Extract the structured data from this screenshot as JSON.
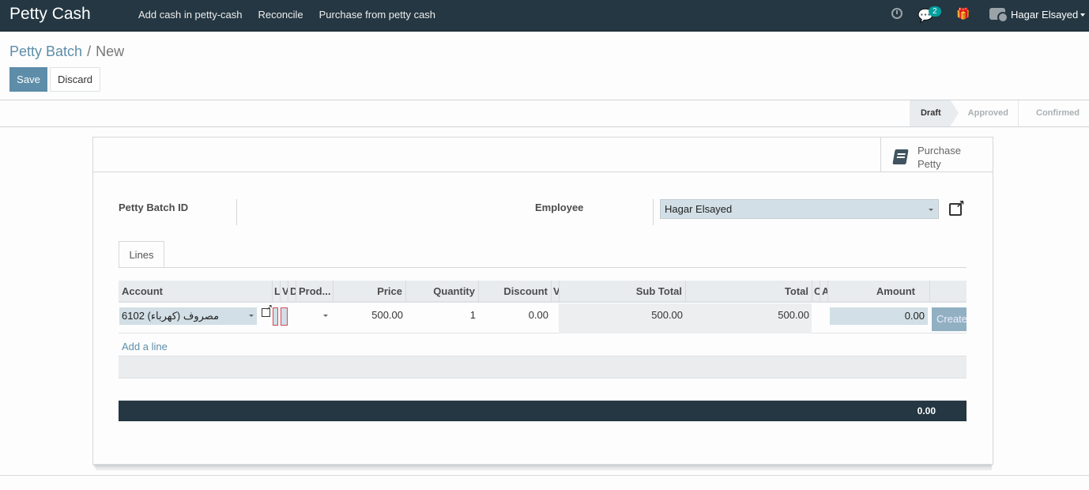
{
  "navbar": {
    "app_title": "Petty Cash",
    "menu_items": [
      "Add cash in petty-cash",
      "Reconcile",
      "Purchase from petty cash"
    ],
    "messages_badge": "2",
    "user_name": "Hagar Elsayed",
    "icons": [
      "clock-icon",
      "chat-icon",
      "gift-icon",
      "camera-avatar-icon",
      "caret-down-icon"
    ]
  },
  "breadcrumb": {
    "parent": "Petty Batch",
    "separator": "/",
    "current": "New"
  },
  "toolbar": {
    "save_label": "Save",
    "discard_label": "Discard"
  },
  "statusbar": {
    "stages": [
      "Draft",
      "Approved",
      "Confirmed"
    ],
    "active_stage": "Draft"
  },
  "smart_button": {
    "line1": "Purchase",
    "line2": "Petty",
    "icon": "book-icon"
  },
  "form": {
    "batch_id_label": "Petty Batch ID",
    "batch_id_value": "",
    "employee_label": "Employee",
    "employee_value": "Hagar Elsayed"
  },
  "tabs": [
    {
      "label": "Lines",
      "active": true
    }
  ],
  "lines_table": {
    "columns": [
      "Account",
      "L",
      "V",
      "D",
      "Prod...",
      "Price",
      "Quantity",
      "Discount",
      "V",
      "Sub Total",
      "Total",
      "C",
      "A",
      "Amount",
      ""
    ],
    "rows": [
      {
        "account": "6102  مصروف (كهرباء)",
        "product": "",
        "price": "500.00",
        "quantity": "1",
        "discount": "0.00",
        "sub_total": "500.00",
        "total": "500.00",
        "amount": "0.00",
        "action_label": "Create"
      }
    ],
    "add_line_label": "Add a line",
    "footer_total": "0.00"
  }
}
